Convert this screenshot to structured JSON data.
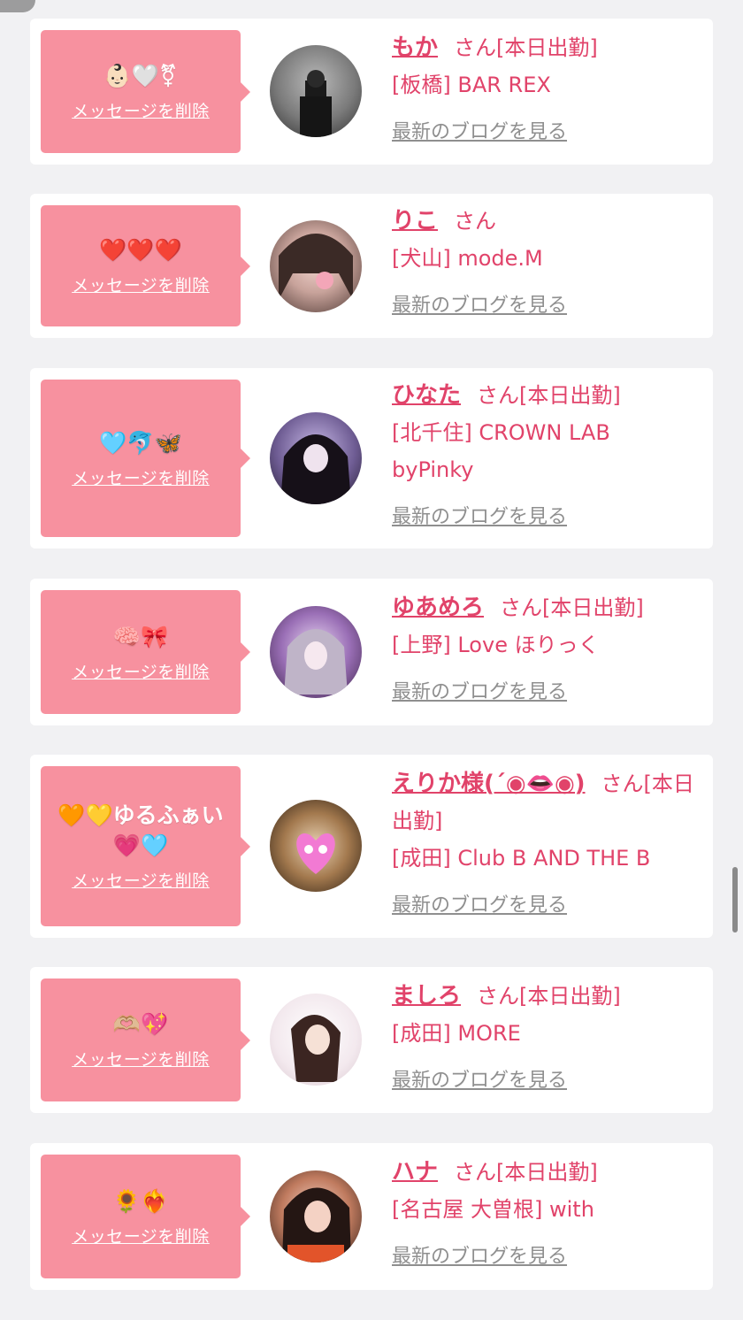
{
  "colors": {
    "accent": "#e1436a",
    "message_bg": "#f7919f",
    "link_gray": "#8f8f8f",
    "page_bg": "#f1f1f3"
  },
  "entries": [
    {
      "message": "👶🏻🤍⚧",
      "delete_label": "メッセージを削除",
      "name": "もか",
      "suffix": "さん[本日出勤]",
      "shop": "[板橋] BAR REX",
      "blog_label": "最新のブログを見る",
      "avatar": "avatar-photo"
    },
    {
      "message": "❤️❤️❤️",
      "delete_label": "メッセージを削除",
      "name": "りこ",
      "suffix": "さん",
      "shop": "[犬山] mode.M",
      "blog_label": "最新のブログを見る",
      "avatar": "avatar-photo"
    },
    {
      "message": "🩵🐬🦋",
      "delete_label": "メッセージを削除",
      "name": "ひなた",
      "suffix": "さん[本日出勤]",
      "shop": "[北千住] CROWN LAB byPinky",
      "blog_label": "最新のブログを見る",
      "avatar": "avatar-photo"
    },
    {
      "message": "🧠🎀",
      "delete_label": "メッセージを削除",
      "name": "ゆあめろ",
      "suffix": "さん[本日出勤]",
      "shop": "[上野] Love ほりっく",
      "blog_label": "最新のブログを見る",
      "avatar": "avatar-photo"
    },
    {
      "message": "🧡💛ゆるふぁい💗🩵",
      "delete_label": "メッセージを削除",
      "name": "えりか様(´◉👄◉)",
      "suffix": "さん[本日出勤]",
      "shop": "[成田] Club B AND THE B",
      "blog_label": "最新のブログを見る",
      "avatar": "avatar-photo"
    },
    {
      "message": "🫶🏼💖",
      "delete_label": "メッセージを削除",
      "name": "ましろ",
      "suffix": "さん[本日出勤]",
      "shop": "[成田] MORE",
      "blog_label": "最新のブログを見る",
      "avatar": "avatar-photo"
    },
    {
      "message": "🌻❤️‍🔥",
      "delete_label": "メッセージを削除",
      "name": "ハナ",
      "suffix": "さん[本日出勤]",
      "shop": "[名古屋 大曽根] with",
      "blog_label": "最新のブログを見る",
      "avatar": "avatar-photo"
    }
  ]
}
